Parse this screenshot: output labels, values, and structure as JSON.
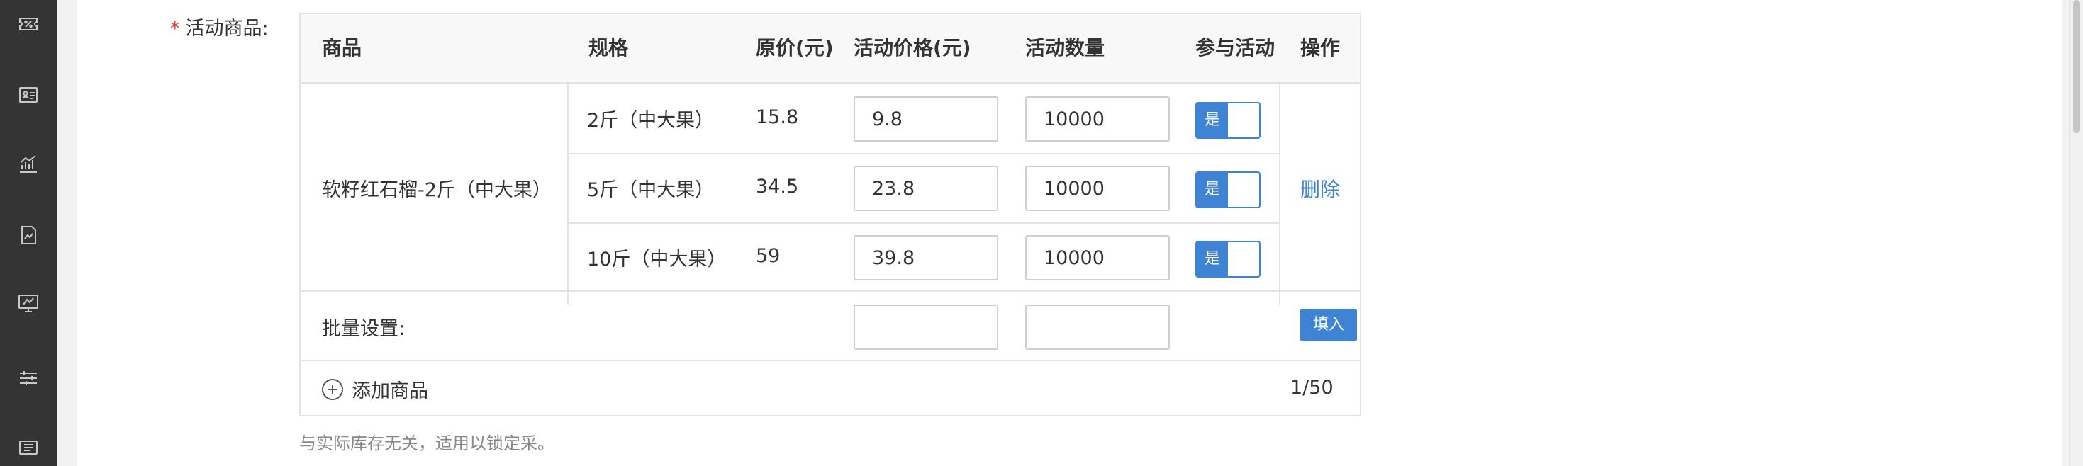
{
  "sidebar": {
    "icons": [
      "ticket-percent-icon",
      "contact-card-icon",
      "trend-chart-icon",
      "report-doc-icon",
      "monitor-stats-icon",
      "sliders-icon",
      "coupon-icon"
    ]
  },
  "form": {
    "required_mark": "*",
    "label": "活动商品:"
  },
  "table": {
    "headers": {
      "product": "商品",
      "spec": "规格",
      "original_price": "原价(元)",
      "activity_price": "活动价格(元)",
      "activity_qty": "活动数量",
      "participate": "参与活动",
      "action": "操作"
    },
    "product_name": "软籽红石榴-2斤（中大果）",
    "rows": [
      {
        "spec": "2斤（中大果）",
        "original_price": "15.8",
        "activity_price": "9.8",
        "activity_qty": "10000",
        "participate": "是"
      },
      {
        "spec": "5斤（中大果）",
        "original_price": "34.5",
        "activity_price": "23.8",
        "activity_qty": "10000",
        "participate": "是"
      },
      {
        "spec": "10斤（中大果）",
        "original_price": "59",
        "activity_price": "39.8",
        "activity_qty": "10000",
        "participate": "是"
      }
    ],
    "delete_label": "删除",
    "batch_label": "批量设置:",
    "batch_price": "",
    "batch_qty": "",
    "fill_label": "填入",
    "add_product_label": "添加商品",
    "count": "1/50"
  },
  "hint": "与实际库存无关，适用以锁定采。",
  "colors": {
    "accent": "#3f84d4",
    "sidebar": "#343434",
    "required": "#e53935"
  }
}
